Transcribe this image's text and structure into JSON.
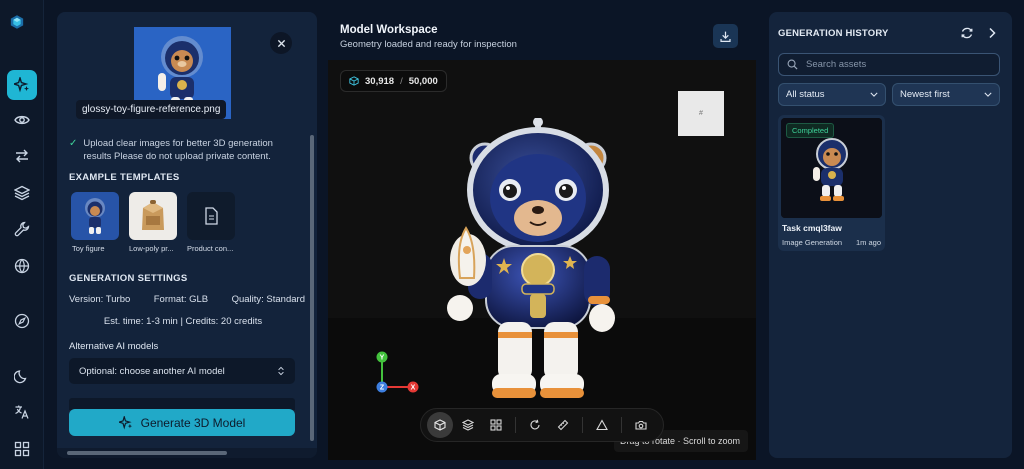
{
  "rail": {
    "items": [
      "logo",
      "sparkle",
      "eye",
      "swap",
      "layers",
      "wrench",
      "globe",
      "compass",
      "moon",
      "translate",
      "grid"
    ]
  },
  "upload": {
    "file_name": "glossy-toy-figure-reference.png",
    "tip": "Upload clear images for better 3D generation results Please do not upload private content."
  },
  "templates": {
    "heading": "EXAMPLE TEMPLATES",
    "items": [
      {
        "label": "Toy figure"
      },
      {
        "label": "Low-poly pr..."
      },
      {
        "label": "Product con..."
      }
    ]
  },
  "settings": {
    "heading": "GENERATION SETTINGS",
    "version": "Version: Turbo",
    "format": "Format: GLB",
    "quality": "Quality: Standard",
    "estimate": "Est. time: 1-3 min | Credits: 20 credits",
    "alt_heading": "Alternative AI models",
    "alt_placeholder": "Optional: choose another AI model",
    "generate_label": "Generate 3D Model"
  },
  "workspace": {
    "title": "Model Workspace",
    "subtitle": "Geometry loaded and ready for inspection",
    "poly_count": "30,918",
    "poly_sep": "/",
    "poly_max": "50,000",
    "preview_glyph": "#",
    "axes": {
      "y": "Y",
      "z": "Z",
      "x": "X"
    },
    "hint": "Drag to rotate · Scroll to zoom",
    "toolbar": [
      "cube",
      "layers",
      "grid",
      "rotate",
      "ruler",
      "triangle",
      "camera"
    ]
  },
  "history": {
    "title": "GENERATION HISTORY",
    "search_placeholder": "Search assets",
    "status_filter": "All status",
    "sort": "Newest first",
    "cards": [
      {
        "badge": "Completed",
        "title": "Task cmql3faw",
        "type": "Image Generation",
        "time": "1m ago"
      }
    ]
  },
  "colors": {
    "accent": "#21a9c8",
    "background": "#0b1526",
    "panel": "#13233b",
    "success": "#3fd39a",
    "axis_x": "#e53935",
    "axis_y": "#43c23d",
    "axis_z": "#3d7fe0"
  }
}
